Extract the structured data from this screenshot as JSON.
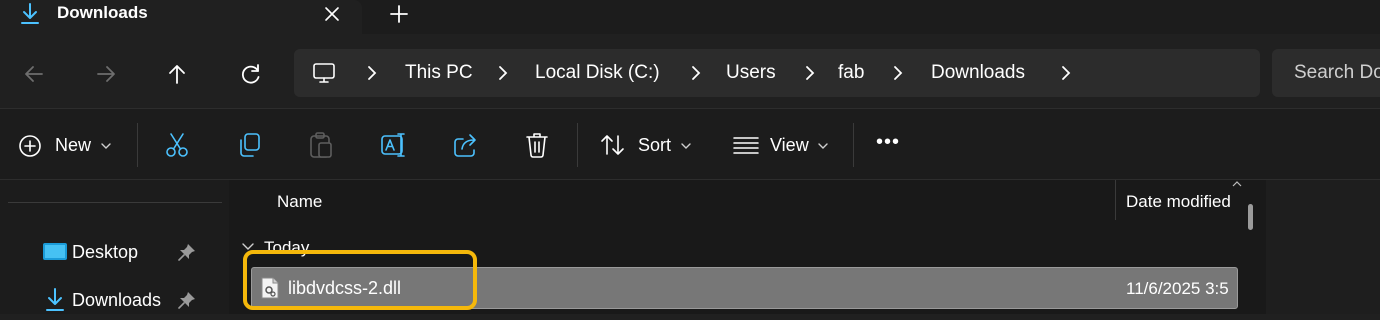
{
  "tab": {
    "title": "Downloads",
    "icon": "download-icon"
  },
  "nav": {
    "back_icon": "arrow-left-icon",
    "forward_icon": "arrow-right-icon",
    "up_icon": "arrow-up-icon",
    "refresh_icon": "refresh-icon"
  },
  "breadcrumb": [
    "This PC",
    "Local Disk (C:)",
    "Users",
    "fab",
    "Downloads"
  ],
  "search": {
    "placeholder": "Search Downloads"
  },
  "toolbar": {
    "new_label": "New",
    "sort_label": "Sort",
    "view_label": "View",
    "more_label": "•••"
  },
  "navpane": {
    "items": [
      {
        "label": "Desktop",
        "icon": "desktop-icon",
        "pinned": true
      },
      {
        "label": "Downloads",
        "icon": "download-icon",
        "pinned": true
      }
    ]
  },
  "filelist": {
    "columns": {
      "name": "Name",
      "date": "Date modified"
    },
    "group": "Today",
    "rows": [
      {
        "name": "libdvdcss-2.dll",
        "date": "11/6/2025 3:5"
      }
    ]
  },
  "colors": {
    "accent": "#4cc2ff",
    "highlight": "#f5b80b",
    "background": "#202020",
    "selected_row": "#777777"
  }
}
